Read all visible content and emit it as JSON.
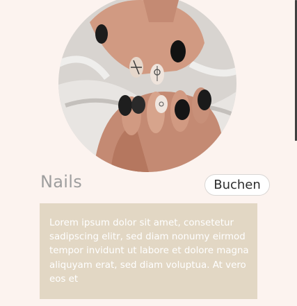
{
  "service": {
    "title": "Nails",
    "book_label": "Buchen",
    "description": "Lorem ipsum dolor sit amet, consetetur sadipscing elitr, sed diam nonumy eirmod tempor invidunt ut labore et dolore magna aliquyam erat, sed diam voluptua. At vero eos et",
    "image_icon": "manicured-hands-photo"
  },
  "colors": {
    "background": "#fcf3ef",
    "description_box": "#e2d7c4",
    "title_text": "#9e9e9e",
    "description_text": "#ffffff"
  }
}
